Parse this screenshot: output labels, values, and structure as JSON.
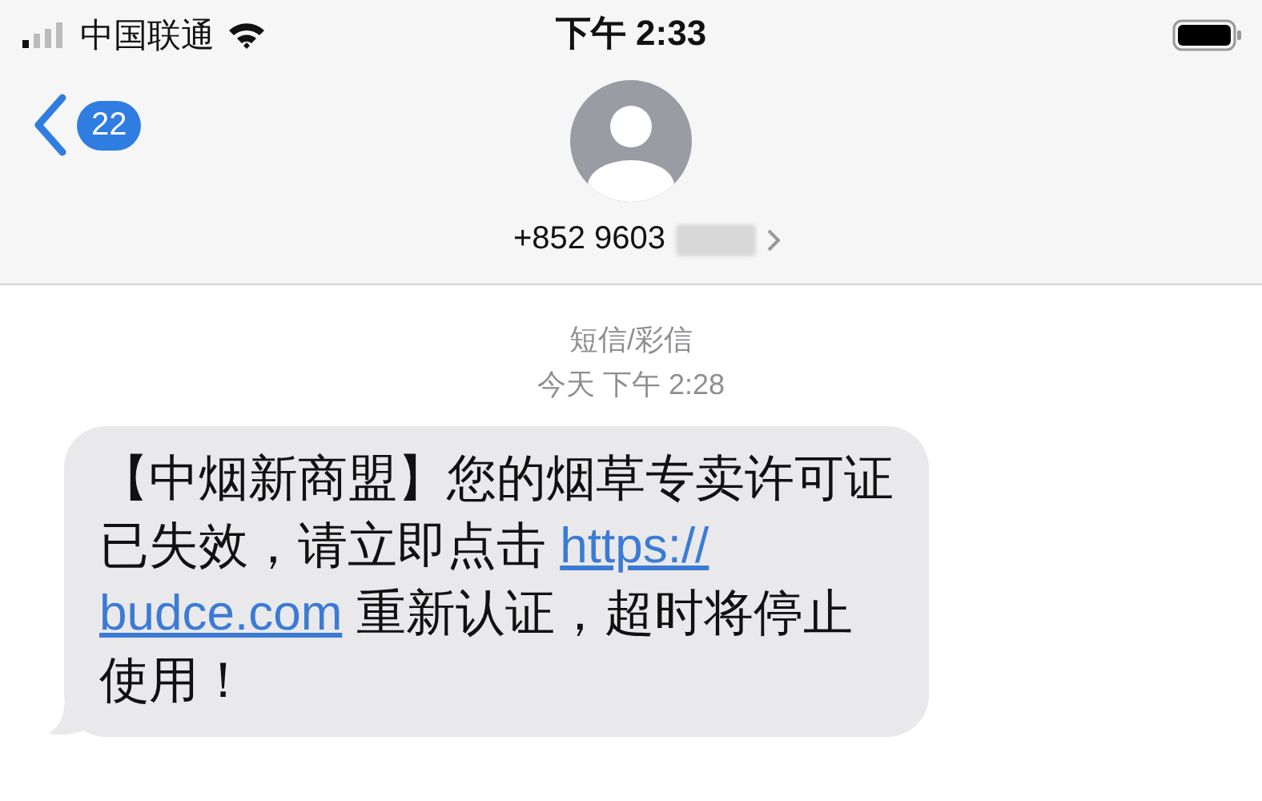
{
  "status_bar": {
    "carrier": "中国联通",
    "time": "下午 2:33"
  },
  "nav": {
    "back_count": "22",
    "contact": "+852 9603",
    "contact_redacted": true
  },
  "thread": {
    "service": "短信/彩信",
    "timestamp": "今天 下午 2:28",
    "messages": [
      {
        "lines": [
          [
            {
              "kind": "text",
              "text": "【中烟新商盟】您的烟草专卖许可证"
            }
          ],
          [
            {
              "kind": "text",
              "text": "已失效，请立即点击 "
            },
            {
              "kind": "link",
              "text": "https://"
            }
          ],
          [
            {
              "kind": "link",
              "text": "budce.com"
            },
            {
              "kind": "text",
              "text": " 重新认证，超时将停止"
            }
          ],
          [
            {
              "kind": "text",
              "text": "使用！"
            }
          ]
        ]
      }
    ]
  }
}
